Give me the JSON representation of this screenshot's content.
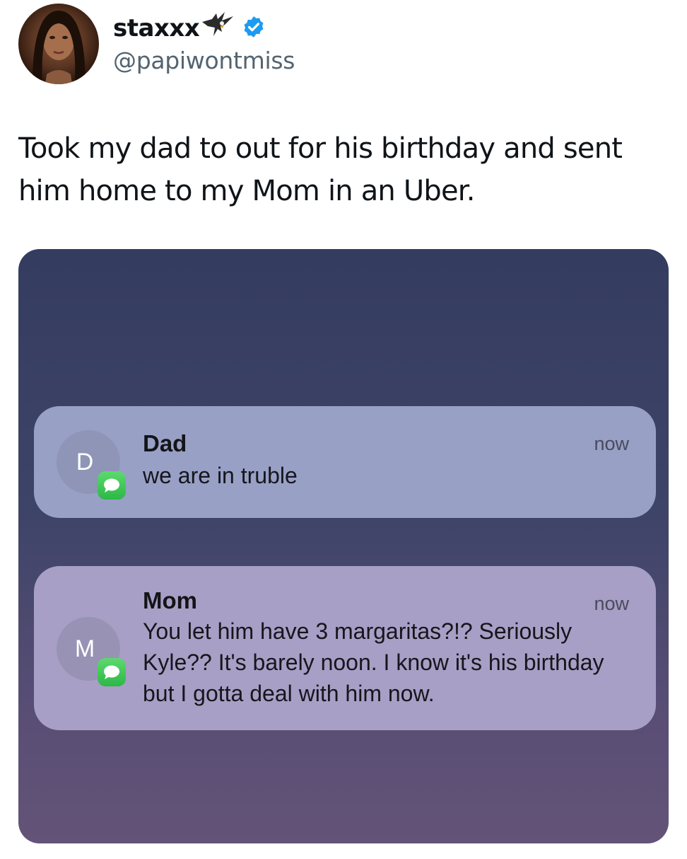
{
  "author": {
    "display_name": "staxxx",
    "handle": "@papiwontmiss",
    "avatar_icon": "profile-photo",
    "decoration_icon": "eagle-icon",
    "verified_icon": "verified-badge-icon",
    "verified_color": "#1d9bf0"
  },
  "tweet": {
    "text": "Took my dad to out for his birthday and sent him home to my Mom in an Uber."
  },
  "screenshot": {
    "background_top": "#343c5f",
    "background_bottom": "#645378",
    "notifications": [
      {
        "avatar_letter": "D",
        "app_icon": "messages-icon",
        "sender": "Dad",
        "time": "now",
        "message": "we are in truble"
      },
      {
        "avatar_letter": "M",
        "app_icon": "messages-icon",
        "sender": "Mom",
        "time": "now",
        "message": "You let him have 3 margaritas?!? Seriously Kyle?? It's barely noon. I know it's his birthday but I gotta deal with him now."
      }
    ]
  }
}
